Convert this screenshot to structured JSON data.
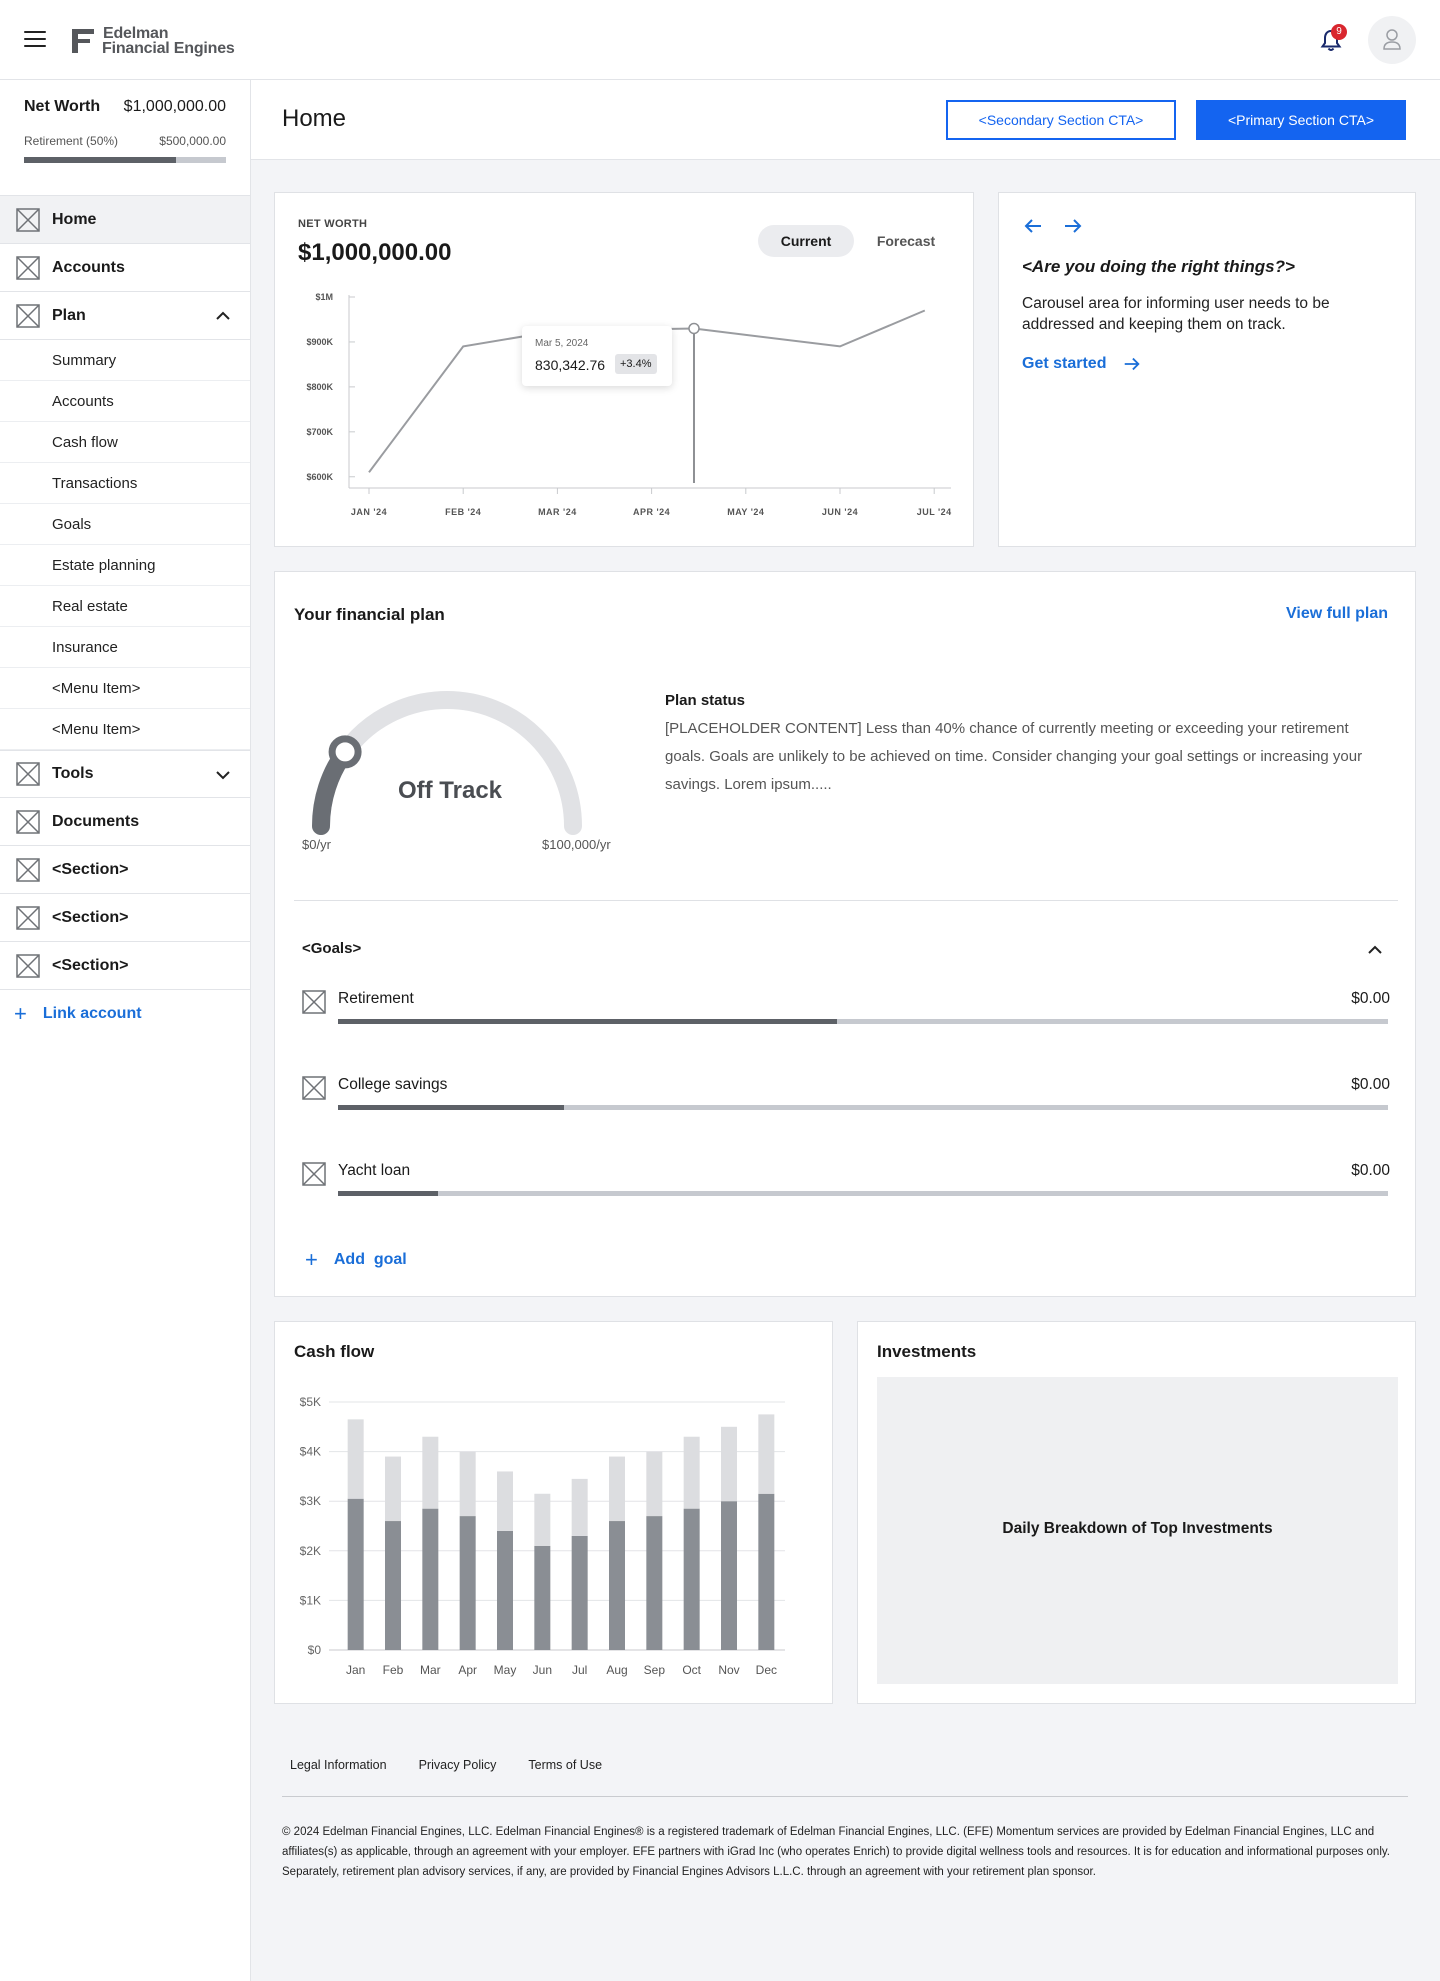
{
  "header": {
    "logo_line1": "Edelman",
    "logo_line2": "Financial Engines",
    "notification_count": "9"
  },
  "sidebar": {
    "net_worth_label": "Net Worth",
    "net_worth_value": "$1,000,000.00",
    "retirement_label": "Retirement (50%)",
    "retirement_value": "$500,000.00",
    "retirement_progress": 0.75,
    "items": [
      {
        "label": "Home"
      },
      {
        "label": "Accounts"
      },
      {
        "label": "Plan"
      },
      {
        "label": "Tools"
      },
      {
        "label": "Documents"
      },
      {
        "label": "<Section>"
      },
      {
        "label": "<Section>"
      },
      {
        "label": "<Section>"
      }
    ],
    "plan_sub": [
      "Summary",
      "Accounts",
      "Cash flow",
      "Transactions",
      "Goals",
      "Estate planning",
      "Real estate",
      "Insurance",
      "<Menu Item>",
      "<Menu Item>"
    ],
    "link_account": "Link account"
  },
  "page": {
    "title": "Home",
    "secondary_cta": "<Secondary Section CTA>",
    "primary_cta": "<Primary Section CTA>"
  },
  "net_worth_card": {
    "label": "NET WORTH",
    "value": "$1,000,000.00",
    "toggle_current": "Current",
    "toggle_forecast": "Forecast",
    "tooltip_date": "Mar 5, 2024",
    "tooltip_value": "830,342.76",
    "tooltip_change": "+3.4%"
  },
  "carousel": {
    "title": "<Are you doing the right things?>",
    "body": "Carousel area for informing user needs to be addressed and keeping them on track.",
    "link": "Get started"
  },
  "plan": {
    "title": "Your financial plan",
    "view_link": "View full plan",
    "gauge_status": "Off Track",
    "gauge_min": "$0/yr",
    "gauge_max": "$100,000/yr",
    "gauge_level": 0.2,
    "status_title": "Plan status",
    "status_body": "[PLACEHOLDER CONTENT] Less than 40% chance of currently meeting or exceeding your retirement goals. Goals are unlikely to be achieved on time. Consider changing your goal settings or increasing your savings. Lorem ipsum.....",
    "goals_title": "<Goals>",
    "goals": [
      {
        "name": "Retirement",
        "value": "$0.00",
        "progress": 0.475
      },
      {
        "name": "College savings",
        "value": "$0.00",
        "progress": 0.215
      },
      {
        "name": "Yacht loan",
        "value": "$0.00",
        "progress": 0.095
      }
    ],
    "add_goal": "Add  goal"
  },
  "cash_flow": {
    "title": "Cash flow"
  },
  "investments": {
    "title": "Investments",
    "placeholder": "Daily Breakdown of Top Investments"
  },
  "footer": {
    "links": [
      "Legal Information",
      "Privacy Policy",
      "Terms of Use"
    ],
    "text": "© 2024 Edelman Financial Engines, LLC. Edelman Financial Engines® is a registered trademark of Edelman Financial Engines, LLC. (EFE) Momentum services are provided by Edelman Financial Engines, LLC and affiliates(s) as applicable, through an agreement with your employer. EFE partners with iGrad Inc (who operates Enrich) to provide digital wellness tools and resources. It is for education and informational purposes only. Separately, retirement plan advisory services, if any, are provided by Financial Engines Advisors L.L.C. through an agreement with your retirement plan sponsor."
  },
  "colors": {
    "accent": "#1464f0",
    "link": "#1a6ed8",
    "badge": "#d9262e",
    "bar_dark": "#5d6167",
    "bar_light": "#c6c9cf"
  },
  "chart_data": [
    {
      "type": "line",
      "x": [
        "JAN '24",
        "FEB '24",
        "MAR '24",
        "APR '24",
        "MAY '24",
        "JUN '24",
        "JUL '24"
      ],
      "ytick_labels": [
        "$600K",
        "$700K",
        "$800K",
        "$900K",
        "$1M"
      ],
      "ylim": [
        575000,
        1000000
      ],
      "points": [
        {
          "x": 0.0,
          "y": 610000
        },
        {
          "x": 1.0,
          "y": 890000
        },
        {
          "x": 2.0,
          "y": 925000
        },
        {
          "x": 3.45,
          "y": 930000
        },
        {
          "x": 5.0,
          "y": 890000
        },
        {
          "x": 5.9,
          "y": 970000
        }
      ],
      "marker_x": 3.45
    },
    {
      "type": "bar",
      "stacked": true,
      "categories": [
        "Jan",
        "Feb",
        "Mar",
        "Apr",
        "May",
        "Jun",
        "Jul",
        "Aug",
        "Sep",
        "Oct",
        "Nov",
        "Dec"
      ],
      "ytick_labels": [
        "$0",
        "$1K",
        "$2K",
        "$3K",
        "$4K",
        "$5K"
      ],
      "ylim": [
        0,
        5000
      ],
      "series": [
        {
          "values": [
            3050,
            2600,
            2850,
            2700,
            2400,
            2100,
            2300,
            2600,
            2700,
            2850,
            3000,
            3150
          ]
        },
        {
          "values": [
            1600,
            1300,
            1450,
            1300,
            1200,
            1050,
            1150,
            1300,
            1300,
            1450,
            1500,
            1600
          ]
        }
      ],
      "grid": true
    }
  ]
}
